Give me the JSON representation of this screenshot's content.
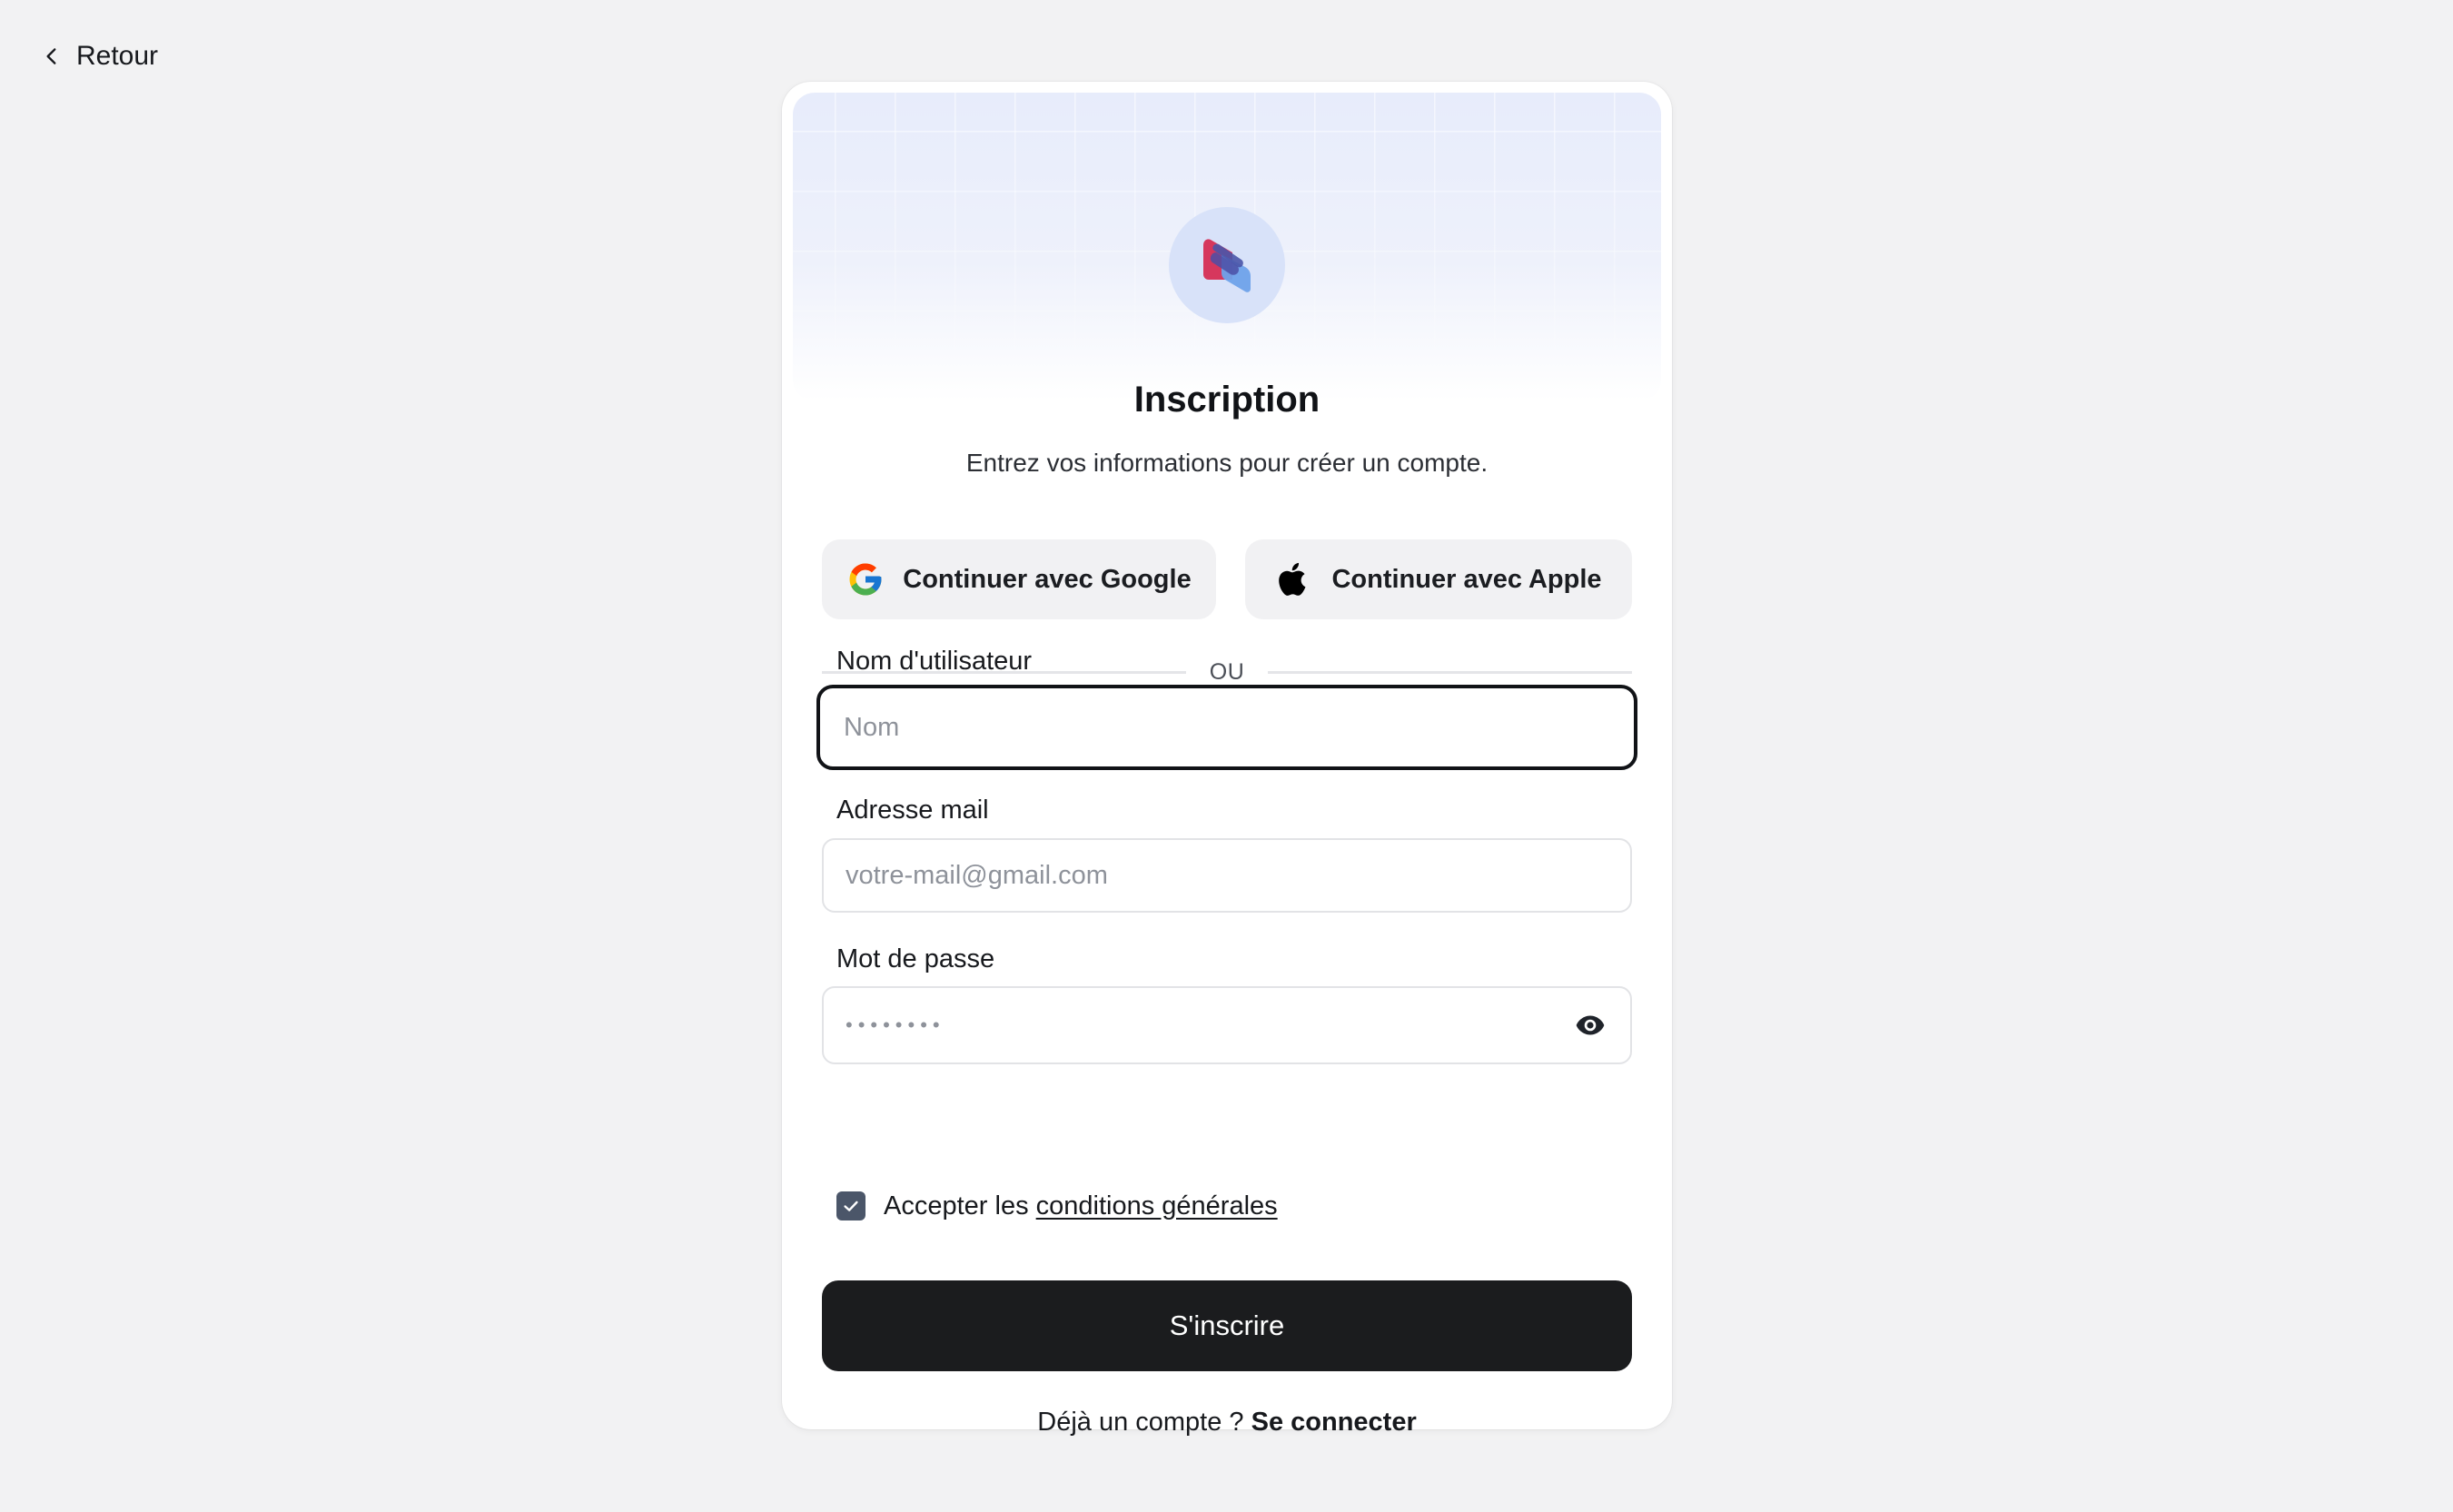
{
  "nav": {
    "back_label": "Retour"
  },
  "header": {
    "title": "Inscription",
    "subtitle": "Entrez vos informations pour créer un compte."
  },
  "social": {
    "google_label": "Continuer avec Google",
    "apple_label": "Continuer avec Apple"
  },
  "divider": {
    "label": "OU"
  },
  "form": {
    "username": {
      "label": "Nom d'utilisateur",
      "placeholder": "Nom",
      "value": ""
    },
    "email": {
      "label": "Adresse mail",
      "placeholder": "votre-mail@gmail.com",
      "value": ""
    },
    "password": {
      "label": "Mot de passe",
      "masked_value": "••••••••"
    },
    "terms": {
      "prefix": "Accepter les ",
      "link": "conditions générales",
      "checked": true
    },
    "submit_label": "S'inscrire"
  },
  "footer": {
    "prompt": "Déjà un compte ? ",
    "link": "Se connecter"
  },
  "icons": {
    "back": "chevron-left-icon",
    "google": "google-icon",
    "apple": "apple-icon",
    "eye": "eye-icon",
    "check": "check-icon",
    "logo": "app-logo"
  },
  "colors": {
    "background": "#f2f2f3",
    "card": "#ffffff",
    "primary_button": "#1b1c1e",
    "checkbox": "#4b5669",
    "logo_circle": "#d8e2f9",
    "logo_red": "#d6375d",
    "logo_blue": "#5b86e0"
  }
}
